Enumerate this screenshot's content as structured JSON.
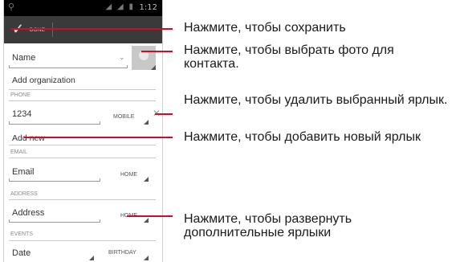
{
  "status_bar": {
    "time": "1:12",
    "signal_icons": "◢ ◢ ▮"
  },
  "action_bar": {
    "done_label": "DONE"
  },
  "form": {
    "name_placeholder": "Name",
    "add_organization": "Add organization",
    "phone_section": "PHONE",
    "phone_value": "1234",
    "phone_label": "MOBILE",
    "add_new": "Add new",
    "email_section": "EMAIL",
    "email_placeholder": "Email",
    "email_label": "HOME",
    "address_section": "ADDRESS",
    "address_placeholder": "Address",
    "address_label": "HOME",
    "events_section": "EVENTS",
    "date_placeholder": "Date",
    "date_label": "BIRTHDAY"
  },
  "callouts": [
    "Нажмите, чтобы сохранить",
    "Нажмите, чтобы выбрать фото для контакта.",
    "Нажмите, чтобы удалить выбранный ярлык.",
    "Нажмите, чтобы добавить новый ярлык",
    "Нажмите, чтобы развернуть дополнительные ярлыки"
  ],
  "colors": {
    "callout_line": "#c8102e",
    "action_bar": "#3a3a3a",
    "status_bar": "#000000"
  },
  "icons": [
    "usb-icon",
    "signal-icon",
    "checkmark-icon",
    "chevron-down-icon",
    "contact-photo-icon",
    "remove-icon"
  ]
}
